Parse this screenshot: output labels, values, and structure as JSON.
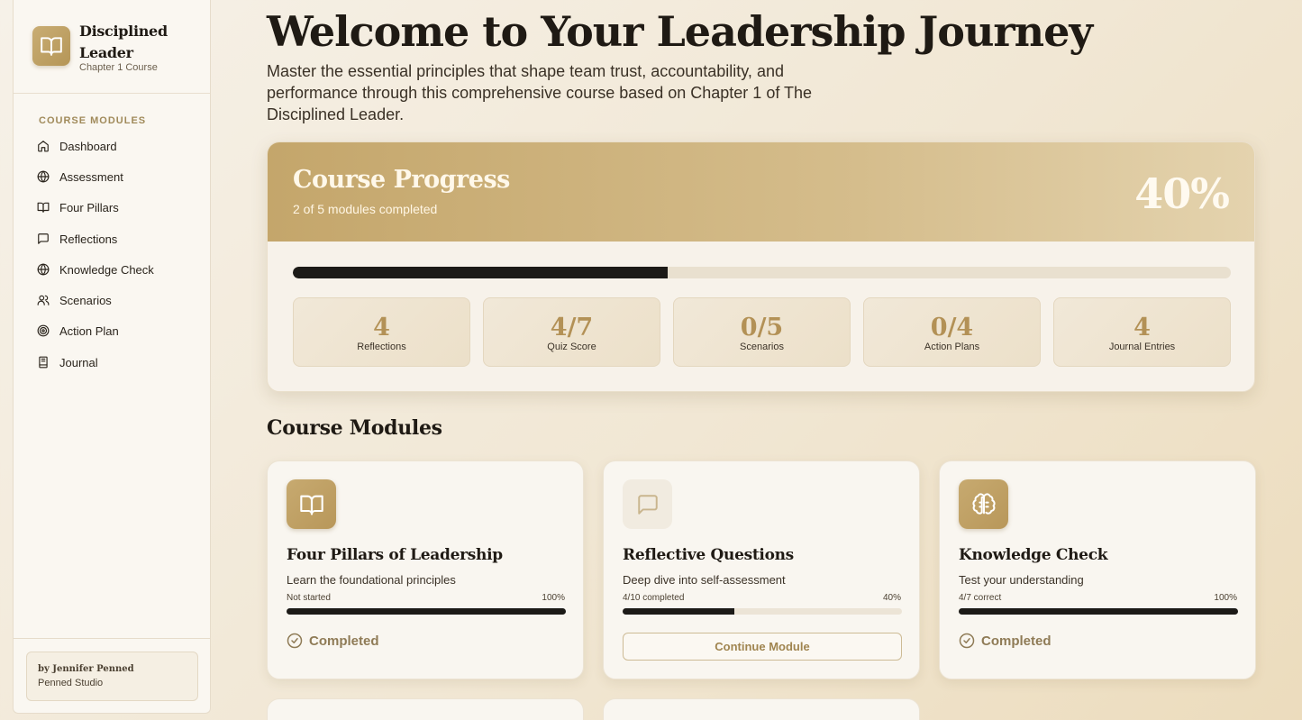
{
  "brand": {
    "title": "Disciplined Leader",
    "subtitle": "Chapter 1 Course",
    "logo_icon": "open-book-icon"
  },
  "sidebar": {
    "heading": "Course Modules",
    "items": [
      {
        "label": "Dashboard",
        "icon": "home-icon"
      },
      {
        "label": "Assessment",
        "icon": "globe-icon"
      },
      {
        "label": "Four Pillars",
        "icon": "book-icon"
      },
      {
        "label": "Reflections",
        "icon": "message-square-icon"
      },
      {
        "label": "Knowledge Check",
        "icon": "globe-icon"
      },
      {
        "label": "Scenarios",
        "icon": "users-icon"
      },
      {
        "label": "Action Plan",
        "icon": "target-icon"
      },
      {
        "label": "Journal",
        "icon": "notebook-icon"
      }
    ],
    "credit_by": "by Jennifer Penned",
    "credit_studio": "Penned Studio"
  },
  "hero": {
    "title": "Welcome to Your Leadership Journey",
    "description": "Master the essential principles that shape team trust, accountability, and performance through this comprehensive course based on Chapter 1 of The Disciplined Leader."
  },
  "progress": {
    "title": "Course Progress",
    "subtitle": "2 of 5 modules completed",
    "percent_label": "40%",
    "percent": 40,
    "stats": [
      {
        "value": "4",
        "label": "Reflections"
      },
      {
        "value": "4/7",
        "label": "Quiz Score"
      },
      {
        "value": "0/5",
        "label": "Scenarios"
      },
      {
        "value": "0/4",
        "label": "Action Plans"
      },
      {
        "value": "4",
        "label": "Journal Entries"
      }
    ]
  },
  "modules": {
    "heading": "Course Modules",
    "cards": [
      {
        "title": "Four Pillars of Leadership",
        "description": "Learn the foundational principles",
        "status": "Not started",
        "percent_label": "100%",
        "percent": 100,
        "action": "Completed",
        "icon": "open-book-icon"
      },
      {
        "title": "Reflective Questions",
        "description": "Deep dive into self-assessment",
        "status": "4/10 completed",
        "percent_label": "40%",
        "percent": 40,
        "action": "Continue Module",
        "icon": "message-square-icon"
      },
      {
        "title": "Knowledge Check",
        "description": "Test your understanding",
        "status": "4/7 correct",
        "percent_label": "100%",
        "percent": 100,
        "action": "Completed",
        "icon": "brain-icon"
      }
    ]
  },
  "colors": {
    "accent": "#c4a66b",
    "progress_fill": "#1c1a17",
    "stat_value": "#b39156"
  }
}
